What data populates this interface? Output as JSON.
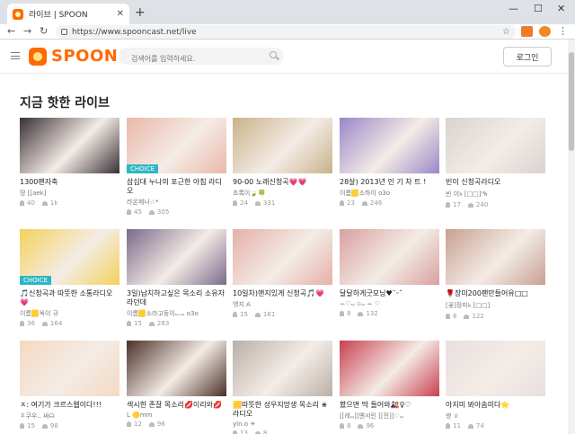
{
  "browser": {
    "tab_title": "라이브 | SPOON",
    "tab_close": "✕",
    "new_tab": "+",
    "url": "https://www.spooncast.net/live",
    "minimize": "—",
    "maximize": "☐",
    "close": "✕",
    "back": "←",
    "forward": "→",
    "reload": "↻",
    "star": "☆",
    "menu": "⋮"
  },
  "header": {
    "logo_text": "SPOON",
    "search_placeholder": "검색어를 입력하세요.",
    "login_label": "로그인"
  },
  "section_title": "지금 핫한 라이브",
  "colors": {
    "accent": "#ff6a00",
    "choice_badge": "#2fb5c4"
  },
  "cards": [
    {
      "title": "1300팬자축",
      "author": "땅 [[aek]",
      "listeners": "40",
      "likes": "1k",
      "choice": "",
      "thumb": "#3a3035"
    },
    {
      "title": "삼십대 누나의 포근한 아침 라디오",
      "author": "라온제나☆*",
      "listeners": "45",
      "likes": "305",
      "choice": "CHOICE",
      "thumb": "#e9b8a8"
    },
    {
      "title": "90-00 노래신청곡💗💗",
      "author": "조록이🍃🍀",
      "listeners": "24",
      "likes": "331",
      "choice": "",
      "thumb": "#c9b28a"
    },
    {
      "title": "28살) 2013년 인 기 차 트 !",
      "author": "이름🟨소하이 o3o",
      "listeners": "23",
      "likes": "246",
      "choice": "",
      "thumb": "#9a86c8"
    },
    {
      "title": "빈이 신청곡라디오",
      "author": "빈 이৳ [□□]'ꚾ",
      "listeners": "17",
      "likes": "240",
      "choice": "",
      "thumb": "#d9d2d0"
    },
    {
      "title": "🎵신청곡과 따뜻한 소통라디오💗",
      "author": "이름🟨옥이 규",
      "listeners": "36",
      "likes": "164",
      "choice": "CHOICE",
      "thumb": "#f3d25a"
    },
    {
      "title": "3일)납치하고싶은 목소리 소유자라던데",
      "author": "이름🟨소라고둥이ᴗ.ᴗ o3o",
      "listeners": "15",
      "likes": "283",
      "choice": "",
      "thumb": "#7a6a8a"
    },
    {
      "title": "10일차)맨지있게 신청곡🎵💗",
      "author": "엣지 A",
      "listeners": "15",
      "likes": "161",
      "choice": "",
      "thumb": "#e4b0a8"
    },
    {
      "title": "달달하게굿모닝♥˘ᵕ˘",
      "author": "ꕀ♡ᴗ ▫ᴗ ꕀ ♡",
      "listeners": "8",
      "likes": "132",
      "choice": "",
      "thumb": "#d8a0a0"
    },
    {
      "title": "🌹장미200팬만들어유□□",
      "author": "[꽃]장미৳ [□□]",
      "listeners": "8",
      "likes": "122",
      "choice": "",
      "thumb": "#c8a090"
    },
    {
      "title": "ㅈ: 여기가 크르스웹이다!!!",
      "author": "ㅈ쿠우.. 싸ᗣ",
      "listeners": "15",
      "likes": "98",
      "choice": "",
      "thumb": "#f5d9c0"
    },
    {
      "title": "섹시한 존잘 목소리💋이리와💋",
      "author": "L 🟡mm",
      "listeners": "12",
      "likes": "96",
      "choice": "",
      "thumb": "#4a3028"
    },
    {
      "title": "🟨따뜻한 성우지망생 목소리 ⋇라디오",
      "author": "yin.o ☀",
      "listeners": "13",
      "likes": "8",
      "choice": "",
      "thumb": "#b8b0a8"
    },
    {
      "title": "봤으면 딱 들어와🎎♀♡",
      "author": "[[레ᴗ]]옌서린 [[전]]♡ᴗ",
      "listeners": "8",
      "likes": "96",
      "choice": "",
      "thumb": "#c84050"
    },
    {
      "title": "아지미 봐아솜미다🌟",
      "author": "쌍 ♕",
      "listeners": "11",
      "likes": "74",
      "choice": "",
      "thumb": "#e8e0e0"
    }
  ]
}
